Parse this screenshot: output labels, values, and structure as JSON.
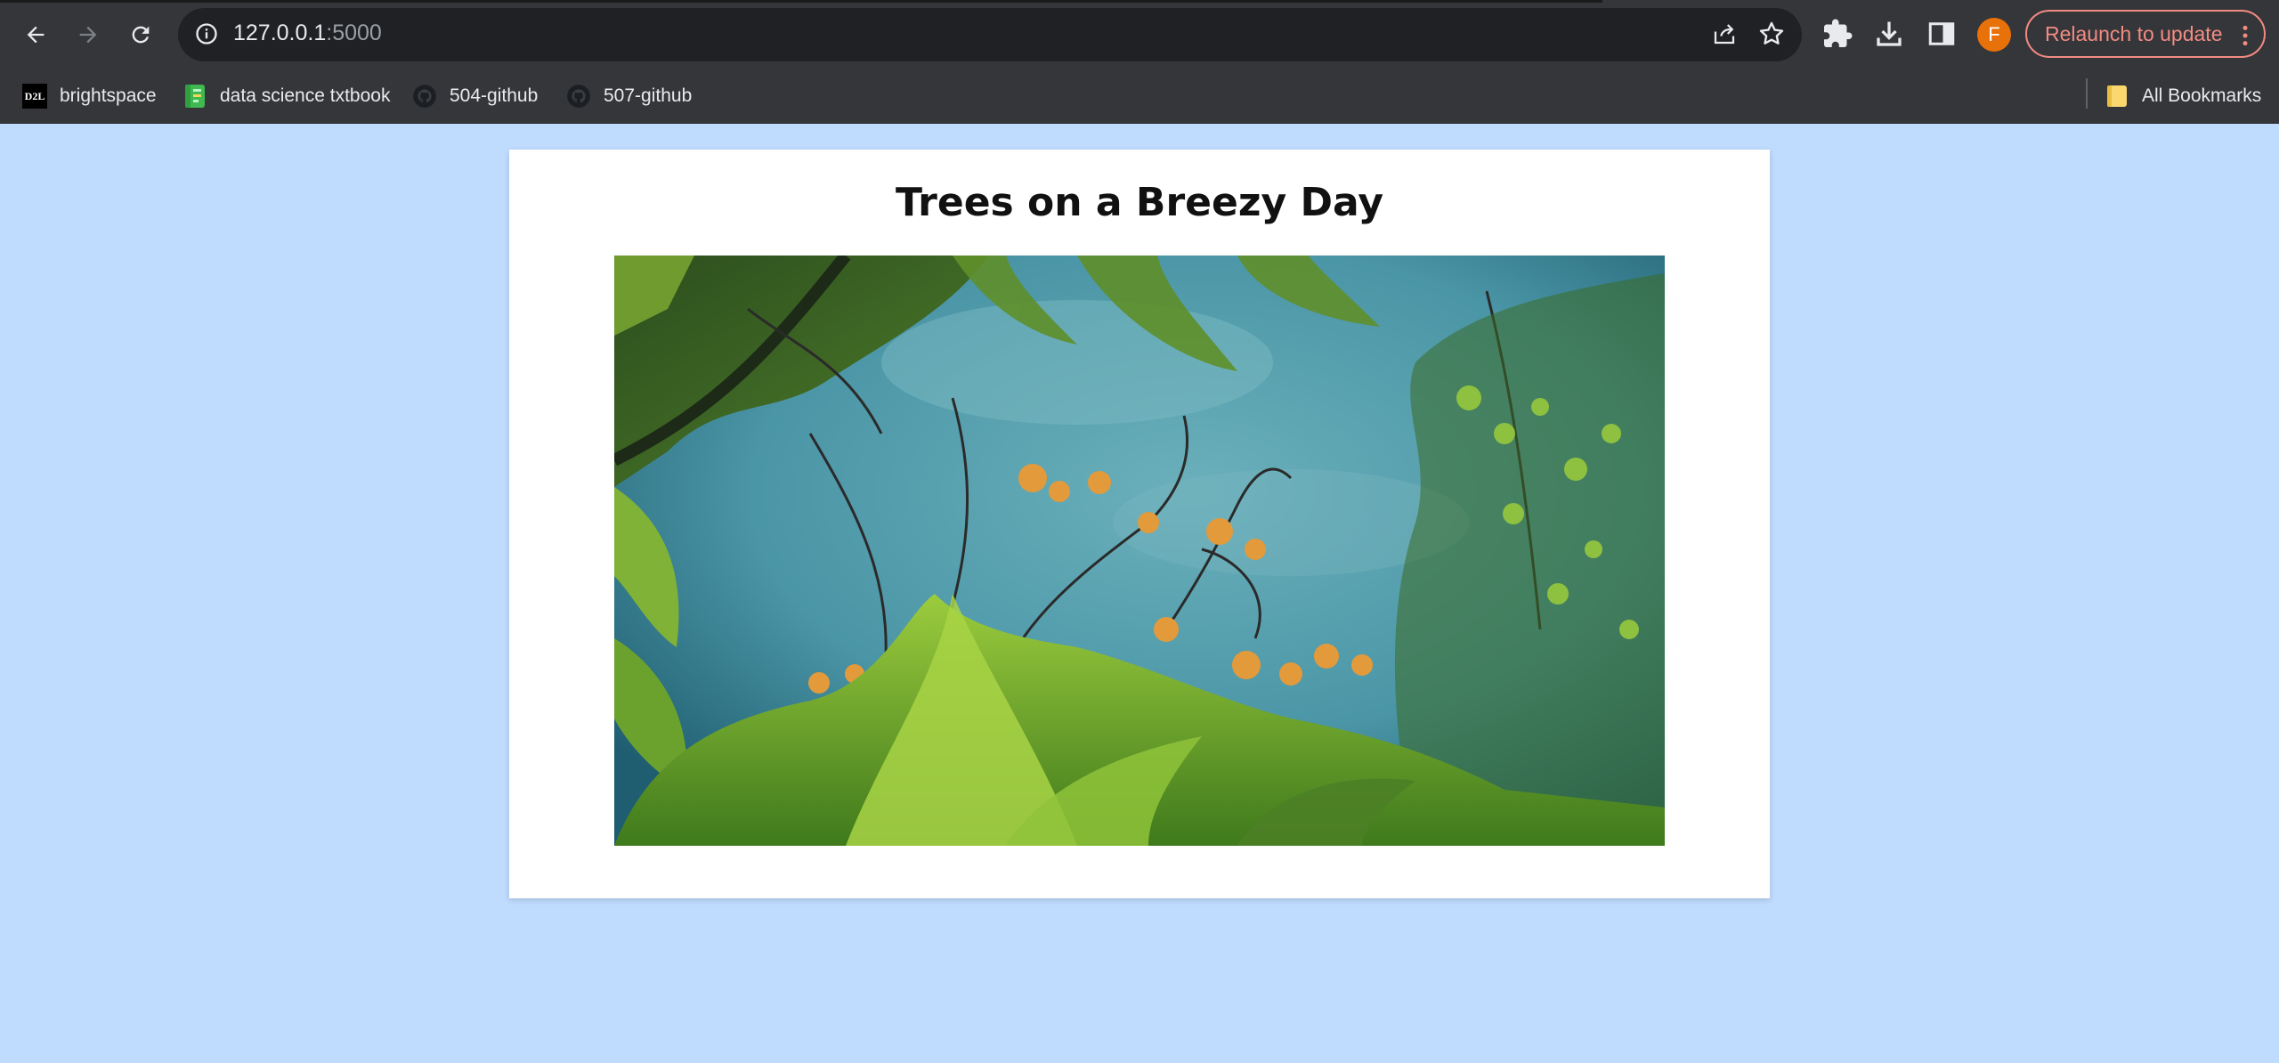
{
  "browser": {
    "url_host": "127.0.0.1",
    "url_port": ":5000",
    "profile_initial": "F",
    "relaunch_label": "Relaunch to update"
  },
  "bookmarks": {
    "items": [
      {
        "label": "brightspace",
        "icon": "d2l-icon"
      },
      {
        "label": "data science txtbook",
        "icon": "book-icon"
      },
      {
        "label": "504-github",
        "icon": "github-icon"
      },
      {
        "label": "507-github",
        "icon": "github-icon"
      }
    ],
    "all_bookmarks": "All Bookmarks",
    "d2l_text": "D2L"
  },
  "page": {
    "title": "Trees on a Breezy Day",
    "image_subject": "Ferns, branches and orange blossoms against a teal sky"
  },
  "colors": {
    "page_background": "#bfdbfe",
    "card": "#ffffff",
    "toolbar": "#35363a",
    "relaunch_accent": "#f28b82",
    "avatar": "#e8710a"
  }
}
